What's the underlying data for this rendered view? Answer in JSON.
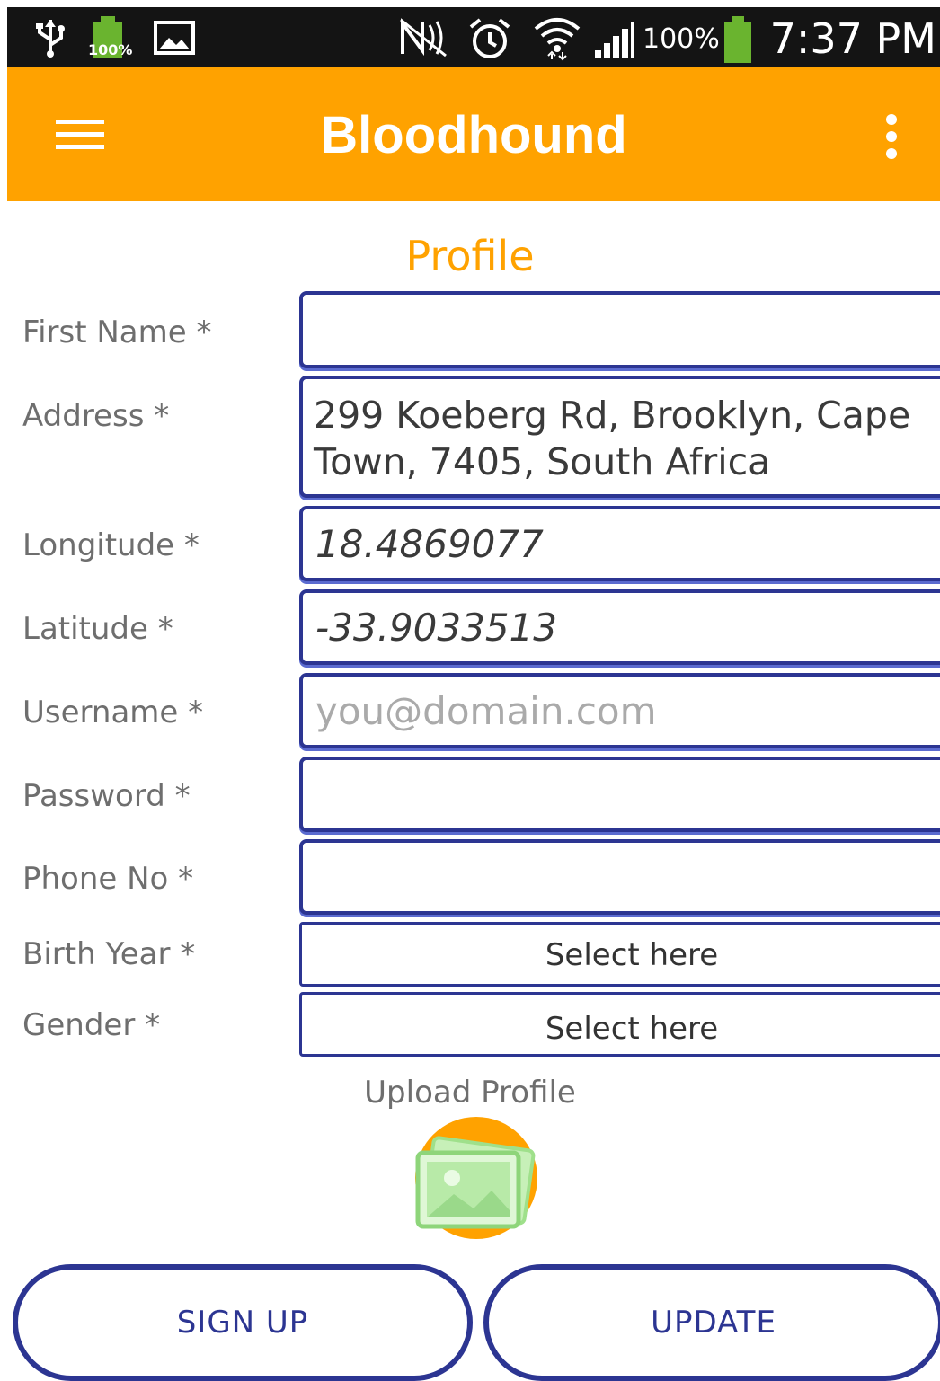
{
  "status_bar": {
    "battery_small_text": "100%",
    "battery_percent": "100%",
    "time": "7:37 PM"
  },
  "app_bar": {
    "title": "Bloodhound",
    "menu_icon": "hamburger-menu-icon",
    "overflow_icon": "more-vert-icon",
    "background_color": "#ffa200"
  },
  "page": {
    "title": "Profile"
  },
  "form": {
    "first_name": {
      "label": "First Name *",
      "value": ""
    },
    "address": {
      "label": "Address *",
      "value": "299 Koeberg Rd, Brooklyn, Cape\nTown, 7405, South Africa"
    },
    "longitude": {
      "label": "Longitude *",
      "value": "18.4869077"
    },
    "latitude": {
      "label": "Latitude *",
      "value": "-33.9033513"
    },
    "username": {
      "label": "Username *",
      "value": "",
      "placeholder": "you@domain.com"
    },
    "password": {
      "label": "Password *",
      "value": ""
    },
    "phone": {
      "label": "Phone No *",
      "value": ""
    },
    "birth_year": {
      "label": "Birth Year *",
      "selected": "Select here"
    },
    "gender": {
      "label": "Gender *",
      "selected": "Select here"
    },
    "border_color": "#2c3592"
  },
  "upload": {
    "label": "Upload Profile",
    "icon": "image-gallery-icon"
  },
  "buttons": {
    "sign_up": "SIGN UP",
    "update": "UPDATE"
  }
}
